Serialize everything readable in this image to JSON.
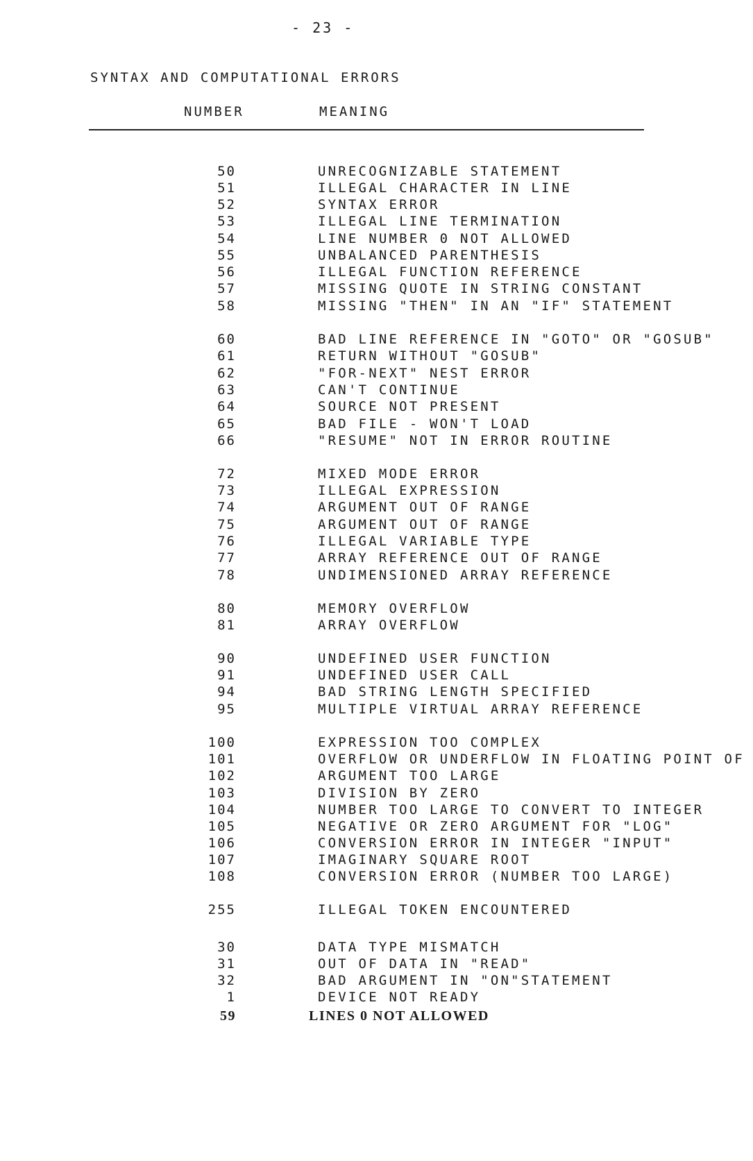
{
  "page_number": "- 23 -",
  "section_title": "SYNTAX AND COMPUTATIONAL ERRORS",
  "columns": {
    "number": "NUMBER",
    "meaning": "MEANING"
  },
  "errors": [
    {
      "number": "50",
      "meaning": "UNRECOGNIZABLE STATEMENT"
    },
    {
      "number": "51",
      "meaning": "ILLEGAL CHARACTER IN LINE"
    },
    {
      "number": "52",
      "meaning": "SYNTAX ERROR"
    },
    {
      "number": "53",
      "meaning": "ILLEGAL LINE TERMINATION"
    },
    {
      "number": "54",
      "meaning": "LINE NUMBER 0 NOT ALLOWED"
    },
    {
      "number": "55",
      "meaning": "UNBALANCED PARENTHESIS"
    },
    {
      "number": "56",
      "meaning": "ILLEGAL FUNCTION REFERENCE"
    },
    {
      "number": "57",
      "meaning": "MISSING QUOTE IN STRING CONSTANT"
    },
    {
      "number": "58",
      "meaning": "MISSING \"THEN\" IN AN \"IF\" STATEMENT"
    },
    {
      "number": "60",
      "meaning": "BAD LINE REFERENCE IN \"GOTO\" OR \"GOSUB\""
    },
    {
      "number": "61",
      "meaning": "RETURN WITHOUT \"GOSUB\""
    },
    {
      "number": "62",
      "meaning": "\"FOR-NEXT\" NEST ERROR"
    },
    {
      "number": "63",
      "meaning": "CAN'T CONTINUE"
    },
    {
      "number": "64",
      "meaning": "SOURCE NOT PRESENT"
    },
    {
      "number": "65",
      "meaning": "BAD FILE - WON'T LOAD"
    },
    {
      "number": "66",
      "meaning": "\"RESUME\" NOT IN ERROR ROUTINE"
    },
    {
      "number": "72",
      "meaning": "MIXED MODE ERROR"
    },
    {
      "number": "73",
      "meaning": "ILLEGAL EXPRESSION"
    },
    {
      "number": "74",
      "meaning": "ARGUMENT OUT OF RANGE"
    },
    {
      "number": "75",
      "meaning": "ARGUMENT OUT OF RANGE"
    },
    {
      "number": "76",
      "meaning": "ILLEGAL VARIABLE TYPE"
    },
    {
      "number": "77",
      "meaning": "ARRAY REFERENCE OUT OF RANGE"
    },
    {
      "number": "78",
      "meaning": "UNDIMENSIONED ARRAY REFERENCE"
    },
    {
      "number": "80",
      "meaning": "MEMORY OVERFLOW"
    },
    {
      "number": "81",
      "meaning": "ARRAY OVERFLOW"
    },
    {
      "number": "90",
      "meaning": "UNDEFINED USER FUNCTION"
    },
    {
      "number": "91",
      "meaning": "UNDEFINED USER CALL"
    },
    {
      "number": "94",
      "meaning": "BAD STRING LENGTH SPECIFIED"
    },
    {
      "number": "95",
      "meaning": "MULTIPLE VIRTUAL ARRAY REFERENCE"
    },
    {
      "number": "100",
      "meaning": "EXPRESSION TOO COMPLEX"
    },
    {
      "number": "101",
      "meaning": "OVERFLOW OR UNDERFLOW IN FLOATING POINT OF"
    },
    {
      "number": "102",
      "meaning": "ARGUMENT TOO LARGE"
    },
    {
      "number": "103",
      "meaning": "DIVISION BY ZERO"
    },
    {
      "number": "104",
      "meaning": "NUMBER TOO LARGE TO CONVERT TO INTEGER"
    },
    {
      "number": "105",
      "meaning": "NEGATIVE OR ZERO ARGUMENT FOR \"LOG\""
    },
    {
      "number": "106",
      "meaning": "CONVERSION ERROR IN INTEGER \"INPUT\""
    },
    {
      "number": "107",
      "meaning": "IMAGINARY SQUARE ROOT"
    },
    {
      "number": "108",
      "meaning": "CONVERSION ERROR (NUMBER TOO LARGE)"
    },
    {
      "number": "255",
      "meaning": "ILLEGAL TOKEN ENCOUNTERED"
    },
    {
      "number": "30",
      "meaning": "DATA TYPE MISMATCH"
    },
    {
      "number": "31",
      "meaning": "OUT OF DATA IN \"READ\""
    },
    {
      "number": "32",
      "meaning": "BAD ARGUMENT IN \"ON\"STATEMENT"
    },
    {
      "number": "1",
      "meaning": "DEVICE NOT READY"
    },
    {
      "number": "59",
      "meaning": "LINES 0 NOT ALLOWED"
    }
  ]
}
